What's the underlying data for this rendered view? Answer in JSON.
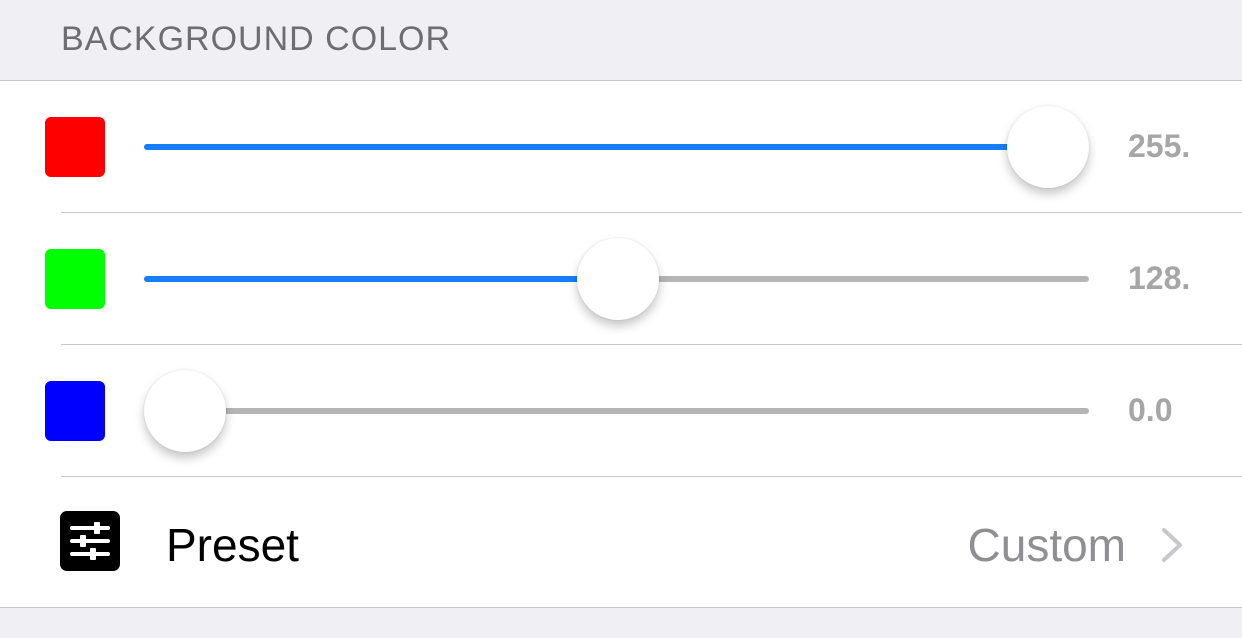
{
  "header": {
    "title": "BACKGROUND COLOR"
  },
  "sliders": [
    {
      "name": "red",
      "swatch_color": "#ff0000",
      "value_text": "255.",
      "fraction": 1.0
    },
    {
      "name": "green",
      "swatch_color": "#00ff00",
      "value_text": "128.",
      "fraction": 0.502
    },
    {
      "name": "blue",
      "swatch_color": "#0000ff",
      "value_text": "0.0",
      "fraction": 0.0
    }
  ],
  "preset": {
    "label": "Preset",
    "value": "Custom",
    "icon": "sliders-icon"
  },
  "colors": {
    "accent": "#157efb",
    "track": "#b5b5b5",
    "value_text": "#a6a6a6"
  }
}
